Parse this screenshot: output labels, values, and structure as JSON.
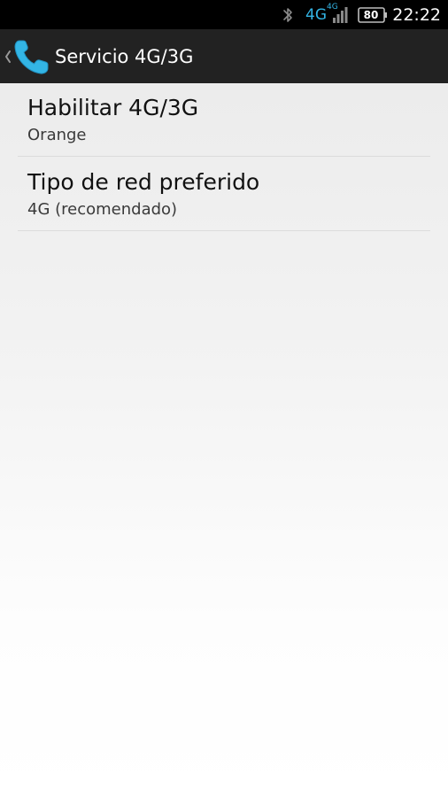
{
  "status_bar": {
    "network_label": "4G",
    "network_sup": "4G",
    "battery_level": "80",
    "time": "22:22",
    "icons": [
      "bluetooth-icon",
      "signal-icon",
      "battery-icon"
    ],
    "accent_color": "#33b5e5"
  },
  "action_bar": {
    "title": "Servicio 4G/3G",
    "app_icon": "phone-icon",
    "up_icon": "back-chevron-icon",
    "icon_color": "#33b5e5"
  },
  "preferences": [
    {
      "title": "Habilitar 4G/3G",
      "summary": "Orange"
    },
    {
      "title": "Tipo de red preferido",
      "summary": "4G (recomendado)"
    }
  ]
}
